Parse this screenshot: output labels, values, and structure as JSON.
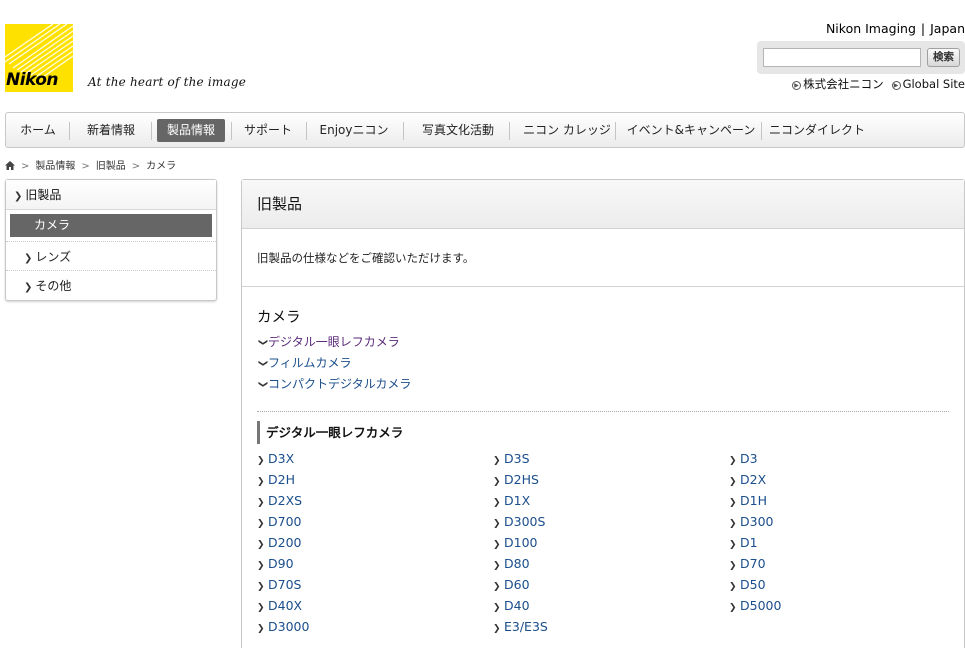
{
  "header": {
    "logo_text": "Nikon",
    "tagline": "At the heart of the image",
    "region_brand": "Nikon Imaging",
    "region_separator": "|",
    "region_country": "Japan",
    "search": {
      "value": "",
      "placeholder": "",
      "button_label": "検索"
    },
    "corp_links": [
      "株式会社ニコン",
      "Global Site"
    ]
  },
  "nav": {
    "items": [
      "ホーム",
      "新着情報",
      "製品情報",
      "サポート",
      "Enjoyニコン",
      "写真文化活動",
      "ニコン カレッジ",
      "イベント&キャンペーン",
      "ニコンダイレクト"
    ],
    "active_index": 2
  },
  "breadcrumb": [
    "製品情報",
    "旧製品",
    "カメラ"
  ],
  "sidebar": {
    "heading": "旧製品",
    "items": [
      "カメラ",
      "レンズ",
      "その他"
    ],
    "current_index": 0
  },
  "main": {
    "title": "旧製品",
    "intro": "旧製品の仕様などをご確認いただけます。",
    "section_title": "カメラ",
    "anchor_links": [
      "デジタル一眼レフカメラ",
      "フィルムカメラ",
      "コンパクトデジタルカメラ"
    ],
    "subsection_title": "デジタル一眼レフカメラ",
    "models": [
      "D3X",
      "D3S",
      "D3",
      "D2H",
      "D2HS",
      "D2X",
      "D2XS",
      "D1X",
      "D1H",
      "D700",
      "D300S",
      "D300",
      "D200",
      "D100",
      "D1",
      "D90",
      "D80",
      "D70",
      "D70S",
      "D60",
      "D50",
      "D40X",
      "D40",
      "D5000",
      "D3000",
      "E3/E3S"
    ]
  },
  "colors": {
    "link": "#1a4e8c",
    "visited": "#5a2a7a",
    "logo_yellow": "#ffe100",
    "active_nav": "#666666"
  }
}
